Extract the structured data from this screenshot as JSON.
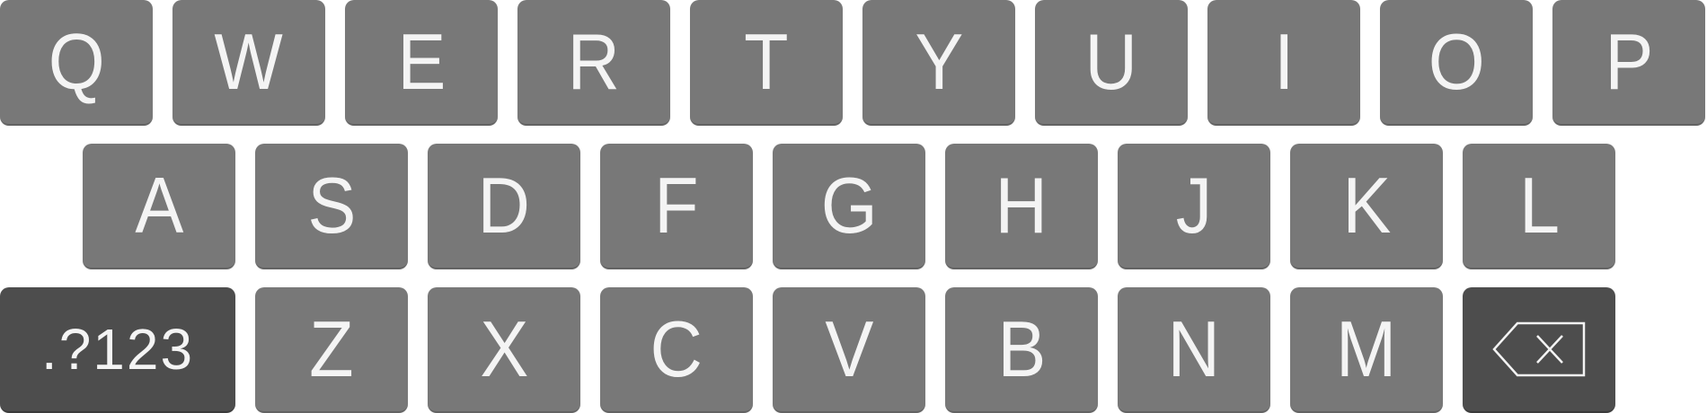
{
  "keyboard": {
    "row1": [
      "Q",
      "W",
      "E",
      "R",
      "T",
      "Y",
      "U",
      "I",
      "O",
      "P"
    ],
    "row2": [
      "A",
      "S",
      "D",
      "F",
      "G",
      "H",
      "J",
      "K",
      "L"
    ],
    "row3": [
      "Z",
      "X",
      "C",
      "V",
      "B",
      "N",
      "M"
    ],
    "symbols_key_label": ".?123",
    "backspace_icon": "backspace-icon"
  },
  "colors": {
    "key": "#787878",
    "dark_key": "#4d4d4d",
    "key_text": "#f4f4f4"
  }
}
